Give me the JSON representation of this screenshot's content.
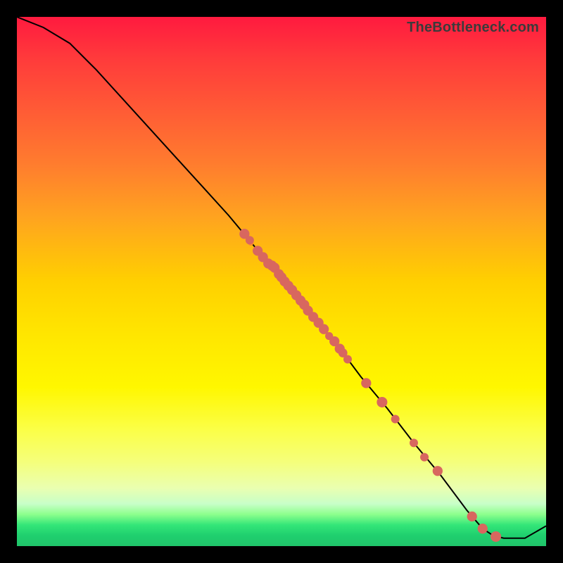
{
  "watermark": "TheBottleneck.com",
  "chart_data": {
    "type": "line",
    "title": "",
    "xlabel": "",
    "ylabel": "",
    "xlim": [
      0,
      100
    ],
    "ylim": [
      0,
      100
    ],
    "series": [
      {
        "name": "curve",
        "x": [
          0,
          5,
          10,
          15,
          20,
          25,
          30,
          35,
          40,
          45,
          50,
          55,
          60,
          65,
          70,
          75,
          80,
          85,
          88,
          90,
          92,
          96,
          100
        ],
        "y": [
          100,
          98,
          95,
          90,
          84.5,
          79,
          73.5,
          68,
          62.5,
          56.5,
          50.8,
          44.5,
          38.7,
          32,
          26,
          19.5,
          13.5,
          6.8,
          3.3,
          2.0,
          1.5,
          1.5,
          3.8
        ]
      }
    ],
    "marker_points": [
      {
        "x": 43.0,
        "y": 59.0,
        "r": 1.1
      },
      {
        "x": 44.0,
        "y": 57.8,
        "r": 0.8
      },
      {
        "x": 45.5,
        "y": 55.8,
        "r": 1.1
      },
      {
        "x": 46.5,
        "y": 54.6,
        "r": 1.1
      },
      {
        "x": 47.5,
        "y": 53.4,
        "r": 1.1
      },
      {
        "x": 48.2,
        "y": 53.0,
        "r": 1.1
      },
      {
        "x": 48.7,
        "y": 52.6,
        "r": 1.1
      },
      {
        "x": 49.5,
        "y": 51.4,
        "r": 1.1
      },
      {
        "x": 50.0,
        "y": 50.8,
        "r": 1.1
      },
      {
        "x": 50.6,
        "y": 50.0,
        "r": 1.1
      },
      {
        "x": 51.3,
        "y": 49.2,
        "r": 1.1
      },
      {
        "x": 52.0,
        "y": 48.4,
        "r": 1.1
      },
      {
        "x": 52.8,
        "y": 47.4,
        "r": 1.1
      },
      {
        "x": 53.6,
        "y": 46.4,
        "r": 1.1
      },
      {
        "x": 54.3,
        "y": 45.6,
        "r": 1.1
      },
      {
        "x": 55.0,
        "y": 44.5,
        "r": 1.1
      },
      {
        "x": 56.0,
        "y": 43.3,
        "r": 1.1
      },
      {
        "x": 57.0,
        "y": 42.2,
        "r": 1.1
      },
      {
        "x": 58.0,
        "y": 41.0,
        "r": 1.1
      },
      {
        "x": 59.0,
        "y": 39.7,
        "r": 0.7
      },
      {
        "x": 60.0,
        "y": 38.7,
        "r": 1.1
      },
      {
        "x": 61.0,
        "y": 37.3,
        "r": 1.1
      },
      {
        "x": 61.6,
        "y": 36.5,
        "r": 0.9
      },
      {
        "x": 62.5,
        "y": 35.3,
        "r": 0.8
      },
      {
        "x": 66.0,
        "y": 30.8,
        "r": 1.1
      },
      {
        "x": 69.0,
        "y": 27.2,
        "r": 1.2
      },
      {
        "x": 71.5,
        "y": 24.0,
        "r": 0.8
      },
      {
        "x": 75.0,
        "y": 19.5,
        "r": 0.8
      },
      {
        "x": 77.0,
        "y": 16.8,
        "r": 0.8
      },
      {
        "x": 79.5,
        "y": 14.2,
        "r": 1.1
      },
      {
        "x": 86.0,
        "y": 5.6,
        "r": 1.1
      },
      {
        "x": 88.0,
        "y": 3.3,
        "r": 1.1
      },
      {
        "x": 90.5,
        "y": 1.8,
        "r": 1.2
      }
    ],
    "gap_point": {
      "x": 44.2,
      "y": 57.3
    },
    "marker_color": "#d8675f",
    "line_color": "#000000"
  },
  "frame": {
    "inner_left": 24,
    "inner_top": 24,
    "inner_w": 752,
    "inner_h": 752
  }
}
